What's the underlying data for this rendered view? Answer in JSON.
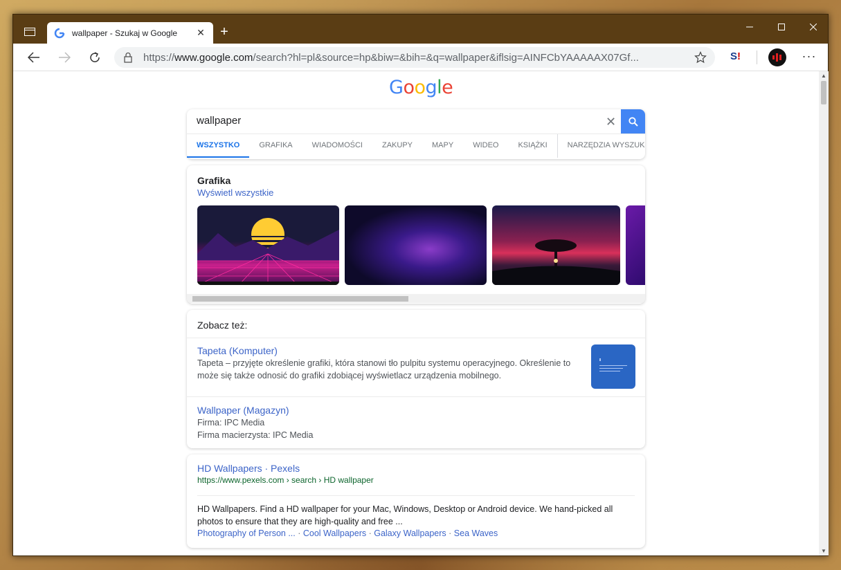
{
  "browser": {
    "tab_title": "wallpaper - Szukaj w Google",
    "url_prefix": "https://",
    "url_host": "www.google.com",
    "url_rest": "/search?hl=pl&source=hp&biw=&bih=&q=wallpaper&iflsig=AINFCbYAAAAAX07Gf...",
    "menu_label": "···",
    "new_tab_label": "+",
    "tab_close_label": "✕"
  },
  "search": {
    "query": "wallpaper",
    "clear_label": "✕",
    "tabs": [
      {
        "label": "WSZYSTKO"
      },
      {
        "label": "GRAFIKA"
      },
      {
        "label": "WIADOMOŚCI"
      },
      {
        "label": "ZAKUPY"
      },
      {
        "label": "MAPY"
      },
      {
        "label": "WIDEO"
      },
      {
        "label": "KSIĄŻKI"
      },
      {
        "label": "NARZĘDZIA WYSZUKIWANIA"
      }
    ]
  },
  "images_card": {
    "title": "Grafika",
    "link": "Wyświetl wszystkie"
  },
  "see_also": {
    "title": "Zobacz też:",
    "items": [
      {
        "title": "Tapeta (Komputer)",
        "line1": "Tapeta – przyjęte określenie grafiki, która stanowi tło pulpitu systemu operacyjnego. Określenie to",
        "line2": "może się także odnosić do grafiki zdobiącej wyświetlacz urządzenia mobilnego."
      },
      {
        "title": "Wallpaper (Magazyn)",
        "line1": "Firma: IPC Media",
        "line2": "Firma macierzysta: IPC Media"
      }
    ]
  },
  "result": {
    "title": "HD Wallpapers · Pexels",
    "url": "https://www.pexels.com › search › HD wallpaper",
    "desc": "HD Wallpapers. Find a HD wallpaper for your Mac, Windows, Desktop or Android device. We hand-picked all photos to ensure that they are high-quality and free ...",
    "links": [
      "Photography of Person ...",
      "Cool Wallpapers",
      "Galaxy Wallpapers",
      "Sea Waves"
    ]
  },
  "colors": {
    "frame": "#5a3d14",
    "link": "#3c64c8",
    "accent": "#4285f4"
  }
}
